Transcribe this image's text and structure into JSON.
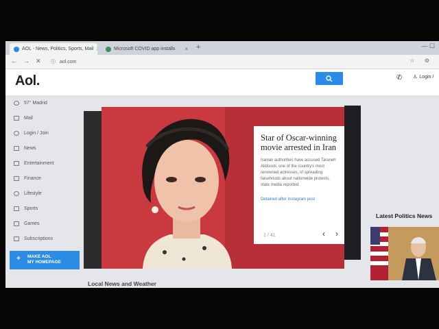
{
  "browser": {
    "tabs": [
      {
        "label": "AOL - News, Politics, Sports, Mail",
        "active": true
      },
      {
        "label": "Microsoft COVID app installs",
        "active": false
      }
    ],
    "new_tab": "+",
    "url": "aol.com"
  },
  "header": {
    "logo": "Aol.",
    "login_label": "Login /"
  },
  "sidebar": {
    "items": [
      {
        "label": "57° Madrid",
        "icon": "weather-icon"
      },
      {
        "label": "Mail",
        "icon": "mail-icon"
      },
      {
        "label": "Login / Join",
        "icon": "user-icon"
      },
      {
        "label": "News",
        "icon": "news-icon"
      },
      {
        "label": "Entertainment",
        "icon": "entertainment-icon"
      },
      {
        "label": "Finance",
        "icon": "finance-icon"
      },
      {
        "label": "Lifestyle",
        "icon": "lifestyle-icon"
      },
      {
        "label": "Sports",
        "icon": "sports-icon"
      },
      {
        "label": "Games",
        "icon": "games-icon"
      },
      {
        "label": "Subscriptions",
        "icon": "subscriptions-icon"
      }
    ],
    "homepage_button": {
      "line1": "MAKE AOL",
      "line2": "MY HOMEPAGE"
    }
  },
  "hero": {
    "title": "Star of Oscar-winning movie arrested in Iran",
    "description": "Iranian authorities have accused Taraneh Alidoosti, one of the country's most renowned actresses, of spreading falsehoods about nationwide protests, state media reported.",
    "link": "Detained after Instagram post",
    "pager": "1 / 41",
    "colors": {
      "background": "#c9393f",
      "card": "#ffffff"
    }
  },
  "right_column": {
    "politics_title": "Latest Politics News"
  },
  "sections": {
    "local_news": "Local News and Weather"
  },
  "colors": {
    "accent": "#2a8ce4",
    "page_bg": "#e4e6ea"
  }
}
